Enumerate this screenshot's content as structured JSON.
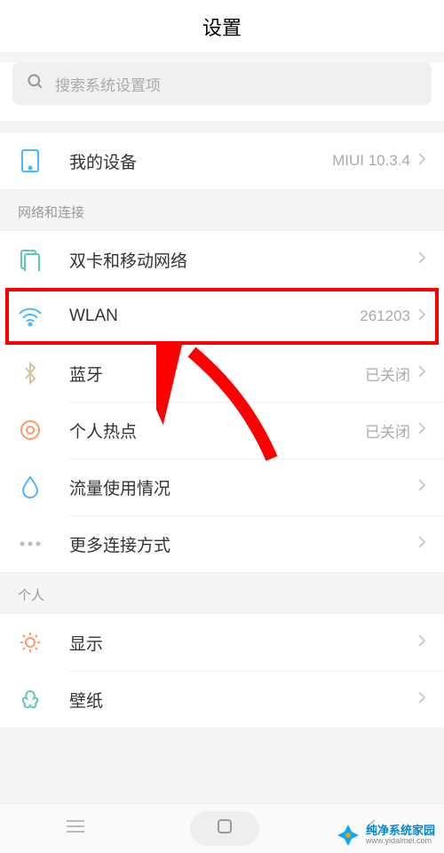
{
  "header": {
    "title": "设置"
  },
  "search": {
    "placeholder": "搜索系统设置项"
  },
  "device": {
    "label": "我的设备",
    "value": "MIUI 10.3.4"
  },
  "sections": {
    "network": {
      "label": "网络和连接",
      "items": [
        {
          "label": "双卡和移动网络",
          "value": ""
        },
        {
          "label": "WLAN",
          "value": "261203"
        },
        {
          "label": "蓝牙",
          "value": "已关闭"
        },
        {
          "label": "个人热点",
          "value": "已关闭"
        },
        {
          "label": "流量使用情况",
          "value": ""
        },
        {
          "label": "更多连接方式",
          "value": ""
        }
      ]
    },
    "personal": {
      "label": "个人",
      "items": [
        {
          "label": "显示",
          "value": ""
        },
        {
          "label": "壁纸",
          "value": ""
        }
      ]
    }
  },
  "watermark": {
    "name": "纯净系统家园",
    "url": "www.yidaimei.com"
  }
}
